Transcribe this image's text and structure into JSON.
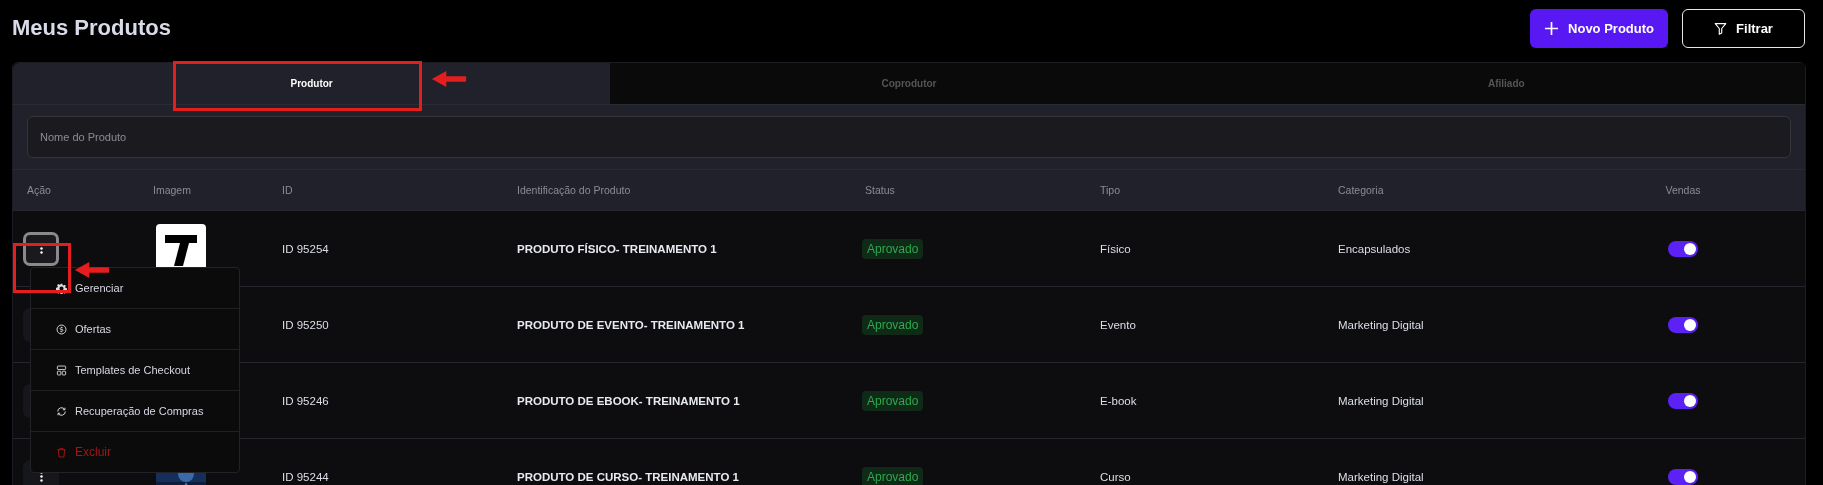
{
  "page": {
    "title": "Meus Produtos"
  },
  "actions": [
    {
      "label": "Novo Produto",
      "kind": "primary"
    },
    {
      "label": "Filtrar",
      "kind": "filter"
    }
  ],
  "tabs": [
    {
      "label": "Produtor",
      "selected": true
    },
    {
      "label": "Coprodutor",
      "selected": false
    },
    {
      "label": "Afiliado",
      "selected": false
    }
  ],
  "search": {
    "placeholder": "Nome do Produto"
  },
  "table": {
    "columns": [
      "Ação",
      "Imagem",
      "ID",
      "Identificação do Produto",
      "Status",
      "Tipo",
      "Categoria",
      "Vendas"
    ],
    "rows": [
      {
        "menu_open": true,
        "image": {
          "kind": "logo"
        },
        "id": "ID 95254",
        "name": "PRODUTO FÍSICO- TREINAMENTO 1",
        "status": "Aprovado",
        "type": "Físico",
        "category": "Encapsulados",
        "sales_on": true
      },
      {
        "menu_open": false,
        "id": "ID 95250",
        "name": "PRODUTO DE EVENTO- TREINAMENTO 1",
        "status": "Aprovado",
        "type": "Evento",
        "category": "Marketing Digital",
        "sales_on": true
      },
      {
        "menu_open": false,
        "id": "ID 95246",
        "name": "PRODUTO DE EBOOK- TREINAMENTO 1",
        "status": "Aprovado",
        "type": "E-book",
        "category": "Marketing Digital",
        "sales_on": true
      },
      {
        "menu_open": false,
        "id": "ID 95244",
        "name": "PRODUTO DE CURSO- TREINAMENTO 1",
        "status": "Aprovado",
        "type": "Curso",
        "category": "Marketing Digital",
        "sales_on": true
      }
    ]
  },
  "row_menu": {
    "items": [
      {
        "label": "Gerenciar",
        "kind": "manage"
      },
      {
        "label": "Ofertas",
        "kind": "offers"
      },
      {
        "label": "Templates de Checkout",
        "kind": "templates"
      },
      {
        "label": "Recuperação de Compras",
        "kind": "recovery"
      },
      {
        "label": "Excluir",
        "kind": "delete"
      }
    ]
  }
}
